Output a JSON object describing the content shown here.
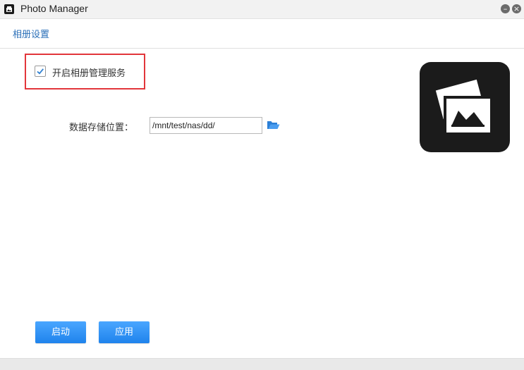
{
  "window": {
    "title": "Photo Manager",
    "app_icon": "photo-manager-icon",
    "minimize_symbol": "–",
    "close_symbol": "×"
  },
  "header": {
    "title": "相册设置"
  },
  "settings": {
    "enable_label": "开启相册管理服务",
    "enable_checked": true,
    "storage_label": "数据存储位置：",
    "storage_path": "/mnt/test/nas/dd/",
    "folder_icon": "folder-open-icon"
  },
  "actions": {
    "start_label": "启动",
    "apply_label": "应用"
  },
  "colors": {
    "accent": "#1f83ec",
    "header_link": "#2a6fb8",
    "highlight_box": "#e2363b",
    "hero_bg": "#1b1b1b"
  }
}
